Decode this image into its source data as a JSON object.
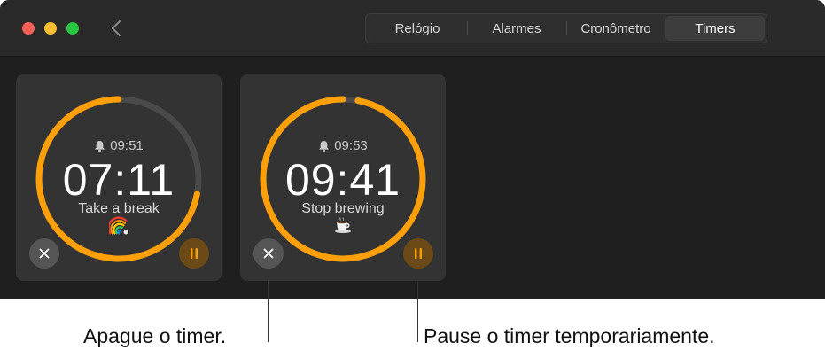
{
  "toolbar": {
    "tabs": [
      {
        "label": "Relógio"
      },
      {
        "label": "Alarmes"
      },
      {
        "label": "Cronômetro"
      },
      {
        "label": "Timers",
        "selected": true
      }
    ]
  },
  "timers": [
    {
      "alarm_time": "09:51",
      "remaining": "07:11",
      "label": "Take a break",
      "emoji": "rainbow",
      "progress": 0.72,
      "state": "running"
    },
    {
      "alarm_time": "09:53",
      "remaining": "09:41",
      "label": "Stop brewing",
      "emoji": "coffee",
      "progress": 0.97,
      "state": "running"
    }
  ],
  "callouts": {
    "cancel": "Apague o timer.",
    "pause": "Pause o timer temporariamente."
  },
  "colors": {
    "accent": "#ff9f0a",
    "ring_track": "#4a4a4a",
    "card": "#333333",
    "window": "#1f1f1f"
  }
}
